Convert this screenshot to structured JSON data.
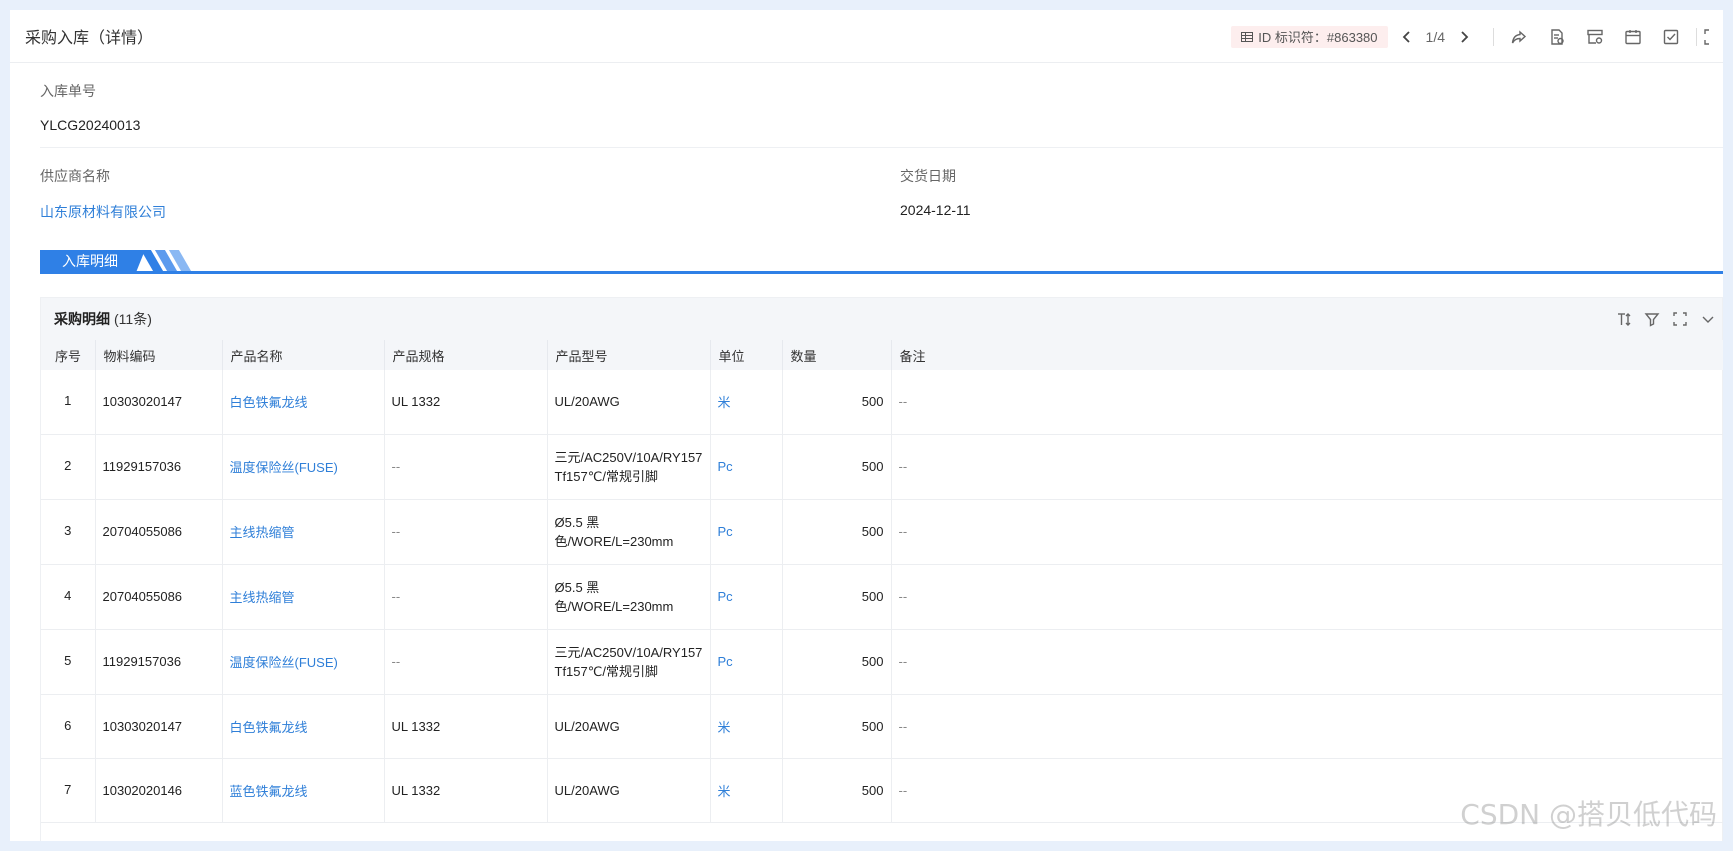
{
  "header": {
    "title": "采购入库（详情）",
    "id_badge": "ID 标识符：#863380",
    "pager": "1/4"
  },
  "form": {
    "order_no_label": "入库单号",
    "order_no": "YLCG20240013",
    "supplier_label": "供应商名称",
    "supplier": "山东原材料有限公司",
    "delivery_label": "交货日期",
    "delivery_date": "2024-12-11"
  },
  "section": {
    "title": "入库明细"
  },
  "table": {
    "title": "采购明细",
    "count": "(11条)",
    "columns": [
      "序号",
      "物料编码",
      "产品名称",
      "产品规格",
      "产品型号",
      "单位",
      "数量",
      "备注"
    ],
    "rows": [
      {
        "idx": "1",
        "code": "10303020147",
        "name": "白色铁氟龙线",
        "spec": "UL 1332",
        "model": "UL/20AWG",
        "unit": "米",
        "qty": "500",
        "note": "--"
      },
      {
        "idx": "2",
        "code": "11929157036",
        "name": "温度保险丝(FUSE)",
        "spec": "--",
        "model": "三元/AC250V/10A/RY157 Tf157℃/常规引脚",
        "unit": "Pc",
        "qty": "500",
        "note": "--"
      },
      {
        "idx": "3",
        "code": "20704055086",
        "name": "主线热缩管",
        "spec": "--",
        "model": "Ø5.5 黑色/WORE/L=230mm",
        "unit": "Pc",
        "qty": "500",
        "note": "--"
      },
      {
        "idx": "4",
        "code": "20704055086",
        "name": "主线热缩管",
        "spec": "--",
        "model": "Ø5.5 黑色/WORE/L=230mm",
        "unit": "Pc",
        "qty": "500",
        "note": "--"
      },
      {
        "idx": "5",
        "code": "11929157036",
        "name": "温度保险丝(FUSE)",
        "spec": "--",
        "model": "三元/AC250V/10A/RY157 Tf157℃/常规引脚",
        "unit": "Pc",
        "qty": "500",
        "note": "--"
      },
      {
        "idx": "6",
        "code": "10303020147",
        "name": "白色铁氟龙线",
        "spec": "UL 1332",
        "model": "UL/20AWG",
        "unit": "米",
        "qty": "500",
        "note": "--"
      },
      {
        "idx": "7",
        "code": "10302020146",
        "name": "蓝色铁氟龙线",
        "spec": "UL 1332",
        "model": "UL/20AWG",
        "unit": "米",
        "qty": "500",
        "note": "--"
      }
    ]
  },
  "watermark": "CSDN @搭贝低代码",
  "colors": {
    "accent": "#2f80e6",
    "link": "#2f7fd8",
    "badge_bg": "#fdeeee"
  }
}
